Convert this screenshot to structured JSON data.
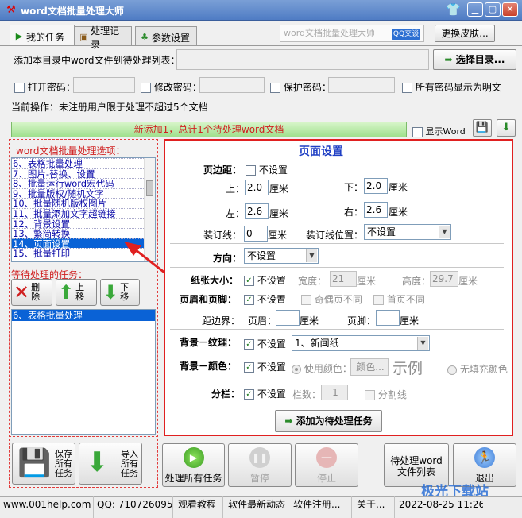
{
  "window": {
    "title": "word文档批量处理大师",
    "minimize": "▁",
    "restore": "▢",
    "close": "✕"
  },
  "tabs": [
    {
      "label": "我的任务"
    },
    {
      "label": "处理记录"
    },
    {
      "label": "参数设置"
    }
  ],
  "ad": {
    "text": "word文档批量处理大师",
    "qq": "QQ交谈"
  },
  "change_skin": "更换皮肤...",
  "add_dir": {
    "label": "添加本目录中word文件到待处理列表：",
    "value": "",
    "button": "选择目录..."
  },
  "passwords": {
    "open": "打开密码：",
    "modify": "修改密码：",
    "protect": "保护密码：",
    "show_plain": "所有密码显示为明文"
  },
  "current_op": "当前操作：未注册用户限于处理不超过5个文档",
  "progress": {
    "text": "新添加1，总计1个待处理word文档",
    "percent": 100
  },
  "show_word": "显示Word",
  "options": {
    "title": "word文档批量处理选项：",
    "items": [
      "6、表格批量处理",
      "7、图片-替换、设置",
      "8、批量运行word宏代码",
      "9、批量版权/随机文字",
      "10、批量随机版权图片",
      "11、批量添加文字超链接",
      "12、背景设置",
      "13、繁简转换",
      "14、页面设置",
      "15、批量打印"
    ],
    "selected": 8
  },
  "pending": {
    "title": "等待处理的任务：",
    "delete": "删除",
    "up": "上移",
    "down": "下移",
    "items": [
      "6、表格批量处理"
    ]
  },
  "page_setup": {
    "title": "页面设置",
    "margin_label": "页边距：",
    "not_set": "不设置",
    "top": "上：",
    "top_val": "2.0",
    "bottom": "下：",
    "bottom_val": "2.0",
    "left": "左：",
    "left_val": "2.6",
    "right": "右：",
    "right_val": "2.6",
    "unit": "厘米",
    "gutter": "装订线：",
    "gutter_val": "0",
    "gutter_pos": "装订线位置：",
    "gutter_pos_val": "不设置",
    "orientation": "方向：",
    "orientation_val": "不设置",
    "paper": "纸张大小：",
    "width": "宽度：",
    "width_val": "21",
    "height": "高度：",
    "height_val": "29.7",
    "header_footer": "页眉和页脚：",
    "odd_even": "奇偶页不同",
    "first_page": "首页不同",
    "edge": "距边界：",
    "header": "页眉：",
    "footer": "页脚：",
    "bg_texture": "背景－纹理：",
    "texture_val": "1、新闻纸",
    "bg_color": "背景－颜色：",
    "use_color": "使用颜色：",
    "color_btn": "颜色...",
    "sample": "示例",
    "no_fill": "无填充颜色",
    "columns": "分栏：",
    "col_count": "栏数：",
    "col_count_val": "1",
    "separator": "分割线",
    "add_btn": "添加为待处理任务"
  },
  "bottom": {
    "save": "保存所有任务",
    "import": "导入所有任务",
    "process_all": "处理所有任务",
    "pause": "暂停",
    "stop": "停止",
    "pending_list": "待处理word文件列表",
    "exit": "退出"
  },
  "status": {
    "site": "www.001help.com",
    "qq": "QQ:  710726095",
    "tutorial": "观看教程",
    "news": "软件最新动态",
    "register": "软件注册...",
    "about": "关于...",
    "datetime": "2022-08-25 11:26"
  },
  "watermark": "极光下载站",
  "colors": {
    "accent": "#0a62d6",
    "red": "#e02020",
    "title_blue": "#1f3fc4"
  }
}
